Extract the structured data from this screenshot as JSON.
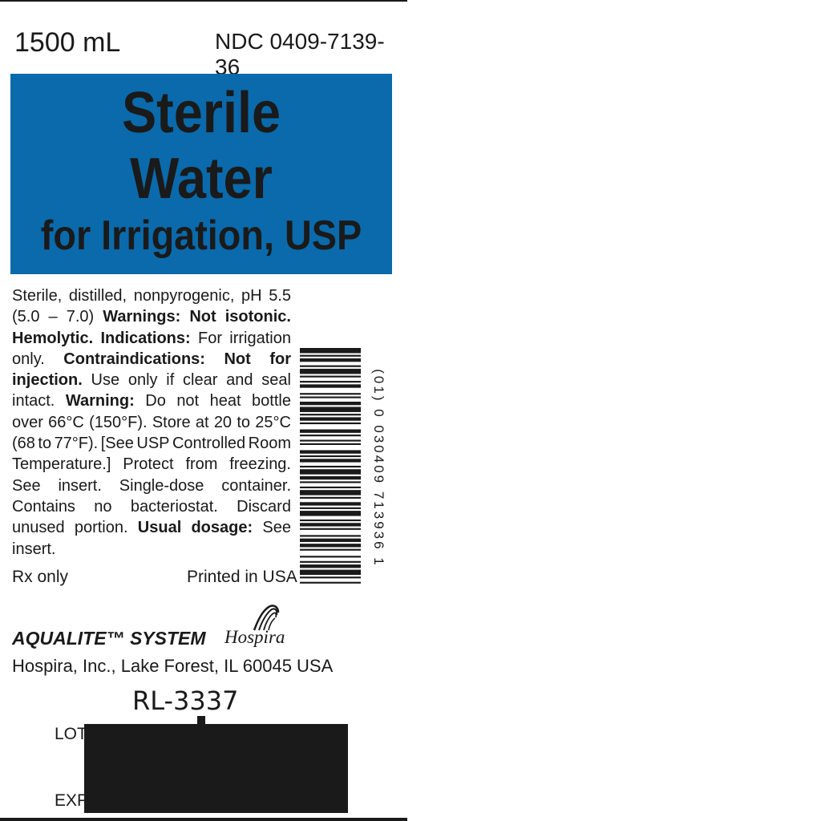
{
  "header": {
    "volume": "1500 mL",
    "ndc": "NDC 0409-7139-36"
  },
  "banner": {
    "line1": "Sterile",
    "line2": "Water",
    "line3": "for Irrigation, USP",
    "background_color": "#0a6aab"
  },
  "body_lines": [
    [
      {
        "t": "Sterile, distilled, nonpyrogenic, pH 5.5",
        "b": false
      }
    ],
    [
      {
        "t": "(5.0 – 7.0) ",
        "b": false
      },
      {
        "t": "Warnings: Not isotonic.",
        "b": true
      }
    ],
    [
      {
        "t": "Hemolytic. Indications: ",
        "b": true
      },
      {
        "t": "For irrigation",
        "b": false
      }
    ],
    [
      {
        "t": "only. ",
        "b": false
      },
      {
        "t": "Contraindications: Not for",
        "b": true
      }
    ],
    [
      {
        "t": "injection. ",
        "b": true
      },
      {
        "t": "Use only if clear and seal",
        "b": false
      }
    ],
    [
      {
        "t": "intact. ",
        "b": false
      },
      {
        "t": "Warning: ",
        "b": true
      },
      {
        "t": "Do not  heat bottle",
        "b": false
      }
    ],
    [
      {
        "t": "over 66°C (150°F). Store at 20 to 25°C",
        "b": false
      }
    ],
    [
      {
        "t": "(68 to 77°F). [See USP Controlled Room",
        "b": false
      }
    ],
    [
      {
        "t": "Temperature.] Protect from freezing.",
        "b": false
      }
    ],
    [
      {
        "t": "See insert. Single-dose container.",
        "b": false
      }
    ],
    [
      {
        "t": "Contains no bacteriostat. Discard",
        "b": false
      }
    ],
    [
      {
        "t": "unused portion. ",
        "b": false
      },
      {
        "t": "Usual dosage: ",
        "b": true
      },
      {
        "t": "See",
        "b": false
      }
    ],
    [
      {
        "t": "insert.",
        "b": false
      }
    ]
  ],
  "footer": {
    "rx": "Rx only",
    "printed": "Printed in USA",
    "system": "AQUALITE™ SYSTEM",
    "brand": "Hospira",
    "address": "Hospira, Inc., Lake Forest, IL 60045 USA",
    "code": "RL-3337",
    "lot_label": "LOT",
    "exp_label": "EXP"
  },
  "barcode": {
    "text": "(01) 0 030409 713936 1"
  },
  "logo": "hospira-logo"
}
